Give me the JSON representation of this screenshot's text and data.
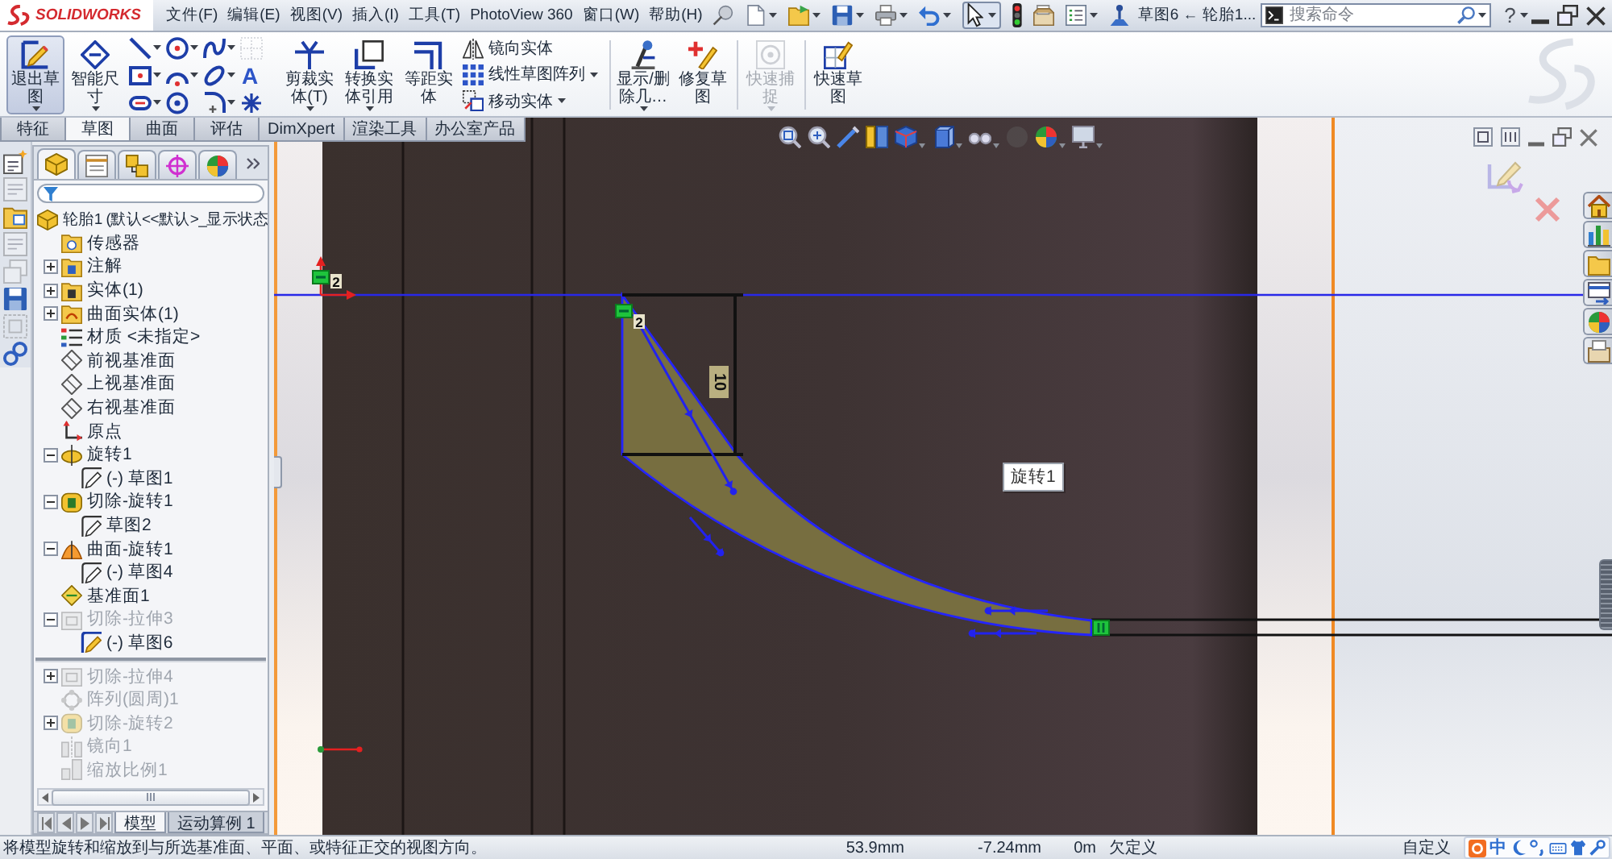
{
  "title_bar": {
    "logo_text": "SOLIDWORKS",
    "menu": [
      "文件(F)",
      "编辑(E)",
      "视图(V)",
      "插入(I)",
      "工具(T)",
      "PhotoView 360",
      "窗口(W)",
      "帮助(H)"
    ],
    "document_title": "草图6 ← 轮胎1...",
    "search": {
      "placeholder": "搜索命令"
    },
    "help": "?"
  },
  "ribbon": {
    "commands": [
      {
        "kind": "large",
        "label": "退出草图",
        "selected": true,
        "disabled": false,
        "dropdown": true
      },
      {
        "kind": "large",
        "label": "智能尺寸",
        "selected": false,
        "disabled": false,
        "dropdown": true
      },
      {
        "kind": "tools",
        "tools": [
          {
            "dropdown": true,
            "disabled": false
          },
          {
            "dropdown": true,
            "disabled": false
          },
          {
            "dropdown": true,
            "disabled": false
          },
          {
            "dropdown": false,
            "disabled": true
          },
          {
            "dropdown": true,
            "disabled": false
          },
          {
            "dropdown": true,
            "disabled": false
          },
          {
            "dropdown": true,
            "disabled": false
          },
          {
            "dropdown": false,
            "disabled": false,
            "glyph": "A"
          },
          {
            "dropdown": true,
            "disabled": false
          },
          {
            "dropdown": false,
            "disabled": false
          },
          {
            "dropdown": true,
            "disabled": false
          },
          {
            "dropdown": false,
            "disabled": false
          }
        ]
      },
      {
        "kind": "large",
        "label": "剪裁实体(T)",
        "selected": false,
        "disabled": false,
        "dropdown": true
      },
      {
        "kind": "large",
        "label": "转换实体引用",
        "selected": false,
        "disabled": false,
        "dropdown": true
      },
      {
        "kind": "large",
        "label": "等距实体",
        "selected": false,
        "disabled": false,
        "dropdown": false
      },
      {
        "kind": "list",
        "items": [
          {
            "label": "镜向实体",
            "dropdown": false
          },
          {
            "label": "线性草图阵列",
            "dropdown": true
          },
          {
            "label": "移动实体",
            "dropdown": true
          }
        ]
      },
      {
        "kind": "large",
        "label": "显示/删除几…",
        "selected": false,
        "disabled": false,
        "dropdown": true
      },
      {
        "kind": "large",
        "label": "修复草图",
        "selected": false,
        "disabled": false,
        "dropdown": false
      },
      {
        "kind": "large",
        "label": "快速捕捉",
        "selected": false,
        "disabled": true,
        "dropdown": true
      },
      {
        "kind": "large",
        "label": "快速草图",
        "selected": false,
        "disabled": false,
        "dropdown": false
      }
    ],
    "tabs": [
      {
        "label": "特征",
        "selected": false
      },
      {
        "label": "草图",
        "selected": true
      },
      {
        "label": "曲面",
        "selected": false
      },
      {
        "label": "评估",
        "selected": false
      },
      {
        "label": "DimXpert",
        "selected": false
      },
      {
        "label": "渲染工具",
        "selected": false
      },
      {
        "label": "办公室产品",
        "selected": false
      }
    ]
  },
  "left_toolbar": [
    {
      "disabled": false
    },
    {
      "disabled": true
    },
    {
      "disabled": false
    },
    {
      "disabled": true
    },
    {
      "disabled": true
    },
    {
      "disabled": false
    },
    {
      "disabled": true
    },
    {
      "disabled": false
    }
  ],
  "feature_manager": {
    "tabs": [
      {
        "selected": true
      },
      {
        "selected": false
      },
      {
        "selected": false
      },
      {
        "selected": false
      },
      {
        "selected": false
      }
    ],
    "tree": [
      {
        "kind": "part",
        "label": "轮胎1 (默认<<默认>_显示状态",
        "disabled": false,
        "children": [
          {
            "kind": "sensor_folder",
            "label": "传感器",
            "disabled": false
          },
          {
            "kind": "annotation_folder",
            "label": "注解",
            "disabled": false,
            "expanded": false
          },
          {
            "kind": "body_folder",
            "label": "实体(1)",
            "disabled": false,
            "expanded": false
          },
          {
            "kind": "surface_folder",
            "label": "曲面实体(1)",
            "disabled": false,
            "expanded": false
          },
          {
            "kind": "material",
            "label": "材质 <未指定>",
            "disabled": false
          },
          {
            "kind": "plane",
            "label": "前视基准面",
            "disabled": false
          },
          {
            "kind": "plane",
            "label": "上视基准面",
            "disabled": false
          },
          {
            "kind": "plane",
            "label": "右视基准面",
            "disabled": false
          },
          {
            "kind": "origin",
            "label": "原点",
            "disabled": false
          },
          {
            "kind": "revolve",
            "label": "旋转1",
            "disabled": false,
            "expanded": true,
            "children": [
              {
                "kind": "sketch",
                "label": "(-) 草图1",
                "disabled": false
              }
            ]
          },
          {
            "kind": "cut_revolve",
            "label": "切除-旋转1",
            "disabled": false,
            "expanded": true,
            "children": [
              {
                "kind": "sketch",
                "label": "草图2",
                "disabled": false
              }
            ]
          },
          {
            "kind": "surface_revolve",
            "label": "曲面-旋转1",
            "disabled": false,
            "expanded": true,
            "children": [
              {
                "kind": "sketch",
                "label": "(-) 草图4",
                "disabled": false
              }
            ]
          },
          {
            "kind": "reference_plane",
            "label": "基准面1",
            "disabled": false
          },
          {
            "kind": "cut_extrude",
            "label": "切除-拉伸3",
            "disabled": true,
            "expanded": true,
            "children": [
              {
                "kind": "sketch_editing",
                "label": "(-) 草图6",
                "disabled": false
              }
            ]
          },
          {
            "kind": "rollback_bar"
          },
          {
            "kind": "cut_extrude",
            "label": "切除-拉伸4",
            "disabled": true,
            "expanded": false
          },
          {
            "kind": "circular_pattern",
            "label": "阵列(圆周)1",
            "disabled": true
          },
          {
            "kind": "cut_revolve",
            "label": "切除-旋转2",
            "disabled": true,
            "expanded": false
          },
          {
            "kind": "mirror",
            "label": "镜向1",
            "disabled": true
          },
          {
            "kind": "scale",
            "label": "缩放比例1",
            "disabled": true
          }
        ]
      }
    ],
    "bottom_tabs": [
      {
        "label": "模型",
        "selected": true
      },
      {
        "label": "运动算例 1",
        "selected": false
      }
    ]
  },
  "graphics": {
    "view_toolbar": [
      {
        "dropdown": false,
        "disabled": false
      },
      {
        "dropdown": false,
        "disabled": false
      },
      {
        "dropdown": false,
        "disabled": false
      },
      {
        "dropdown": false,
        "disabled": false
      },
      {
        "dropdown": true,
        "disabled": false
      },
      {
        "dropdown": true,
        "disabled": false
      },
      {
        "dropdown": true,
        "disabled": false
      },
      {
        "dropdown": false,
        "disabled": true
      },
      {
        "dropdown": true,
        "disabled": false
      },
      {
        "dropdown": true,
        "disabled": false
      }
    ],
    "relations": [
      {
        "kind": "horizontal",
        "count": "2"
      },
      {
        "kind": "horizontal",
        "count": "2"
      },
      {
        "kind": "merge"
      }
    ],
    "dimension": "10",
    "tooltip": "旋转1"
  },
  "status_bar": {
    "message": "将模型旋转和缩放到与所选基准面、平面、或特征正交的视图方向。",
    "x": "53.9mm",
    "y": "-7.24mm",
    "z": "0m",
    "sketch_status": "欠定义",
    "units": "自定义",
    "ime_mode": "中"
  }
}
